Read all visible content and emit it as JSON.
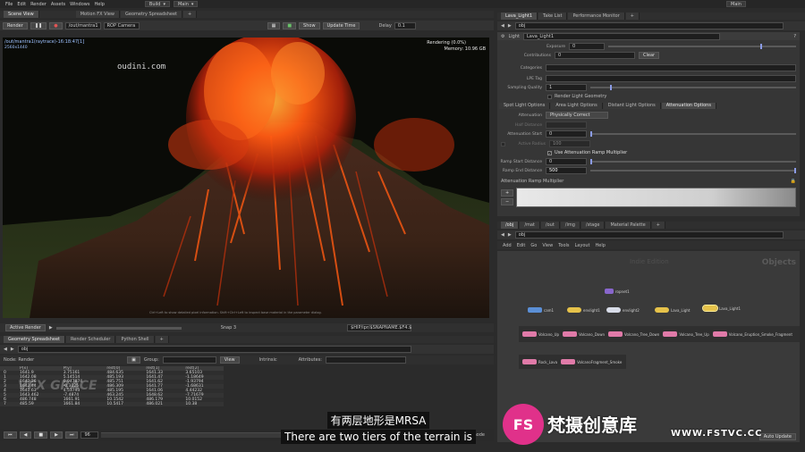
{
  "menu": [
    "File",
    "Edit",
    "Render",
    "Assets",
    "Windows",
    "Help"
  ],
  "desktop": {
    "build": "Build",
    "main": "Main",
    "right_main": "Main"
  },
  "left_tabs": [
    "Scene View",
    "Motion FX View",
    "Geometry Spreadsheet"
  ],
  "right_tabs": [
    "Lava_Light1",
    "Take List",
    "Performance Monitor"
  ],
  "viewport": {
    "render_btn": "Render",
    "node_path": "/out/mantra1",
    "camera": "ROP Camera",
    "show_label": "Show",
    "update_btn": "Update Time",
    "delay_label": "Delay",
    "delay_value": "0.1",
    "info_line1": "/out/mantra1(raytrace)-16:18:47[1]",
    "info_line2": "2560x1440",
    "render_status": "Rendering (0.0%)",
    "memory": "Memory:    10.96 GB",
    "watermark": "oudini.com",
    "hint": "Ctrl+Left to show detailed pixel information. Shift+Ctrl+Left to inspect base material in the parameter dialog.",
    "active_render": "Active Render",
    "snap": "Snap 3",
    "output_path": "$HIP/ipr/$SNAPNAME.$F4.$"
  },
  "spreadsheet": {
    "tabs": [
      "Geometry Spreadsheet",
      "Render Scheduler",
      "Python Shell"
    ],
    "path": "obj",
    "node_label": "Node: Render",
    "group_label": "Group:",
    "view_label": "View",
    "intrinsic_label": "Intrinsic",
    "attributes_label": "Attributes:",
    "columns": [
      "",
      "P[x]",
      "P[y]",
      "rest[0]",
      "rest[1]",
      "rest[2]"
    ],
    "rows": [
      [
        "0",
        "1641.9",
        "3.75161",
        "484.635",
        "1641.33",
        "3.65103"
      ],
      [
        "1",
        "1642.08",
        "5.14514",
        "485.193",
        "1641.47",
        "-1.18649"
      ],
      [
        "2",
        "1642.26",
        "0.947874",
        "485.751",
        "1641.62",
        "-1.93794"
      ],
      [
        "3",
        "1642.44",
        "-0.3125",
        "486.309",
        "1641.77",
        "-1.68631"
      ],
      [
        "4",
        "1641.63",
        "4.53793",
        "485.195",
        "1641.06",
        "4.44232"
      ],
      [
        "5",
        "1643.462",
        "-7.4874",
        "463.245",
        "1648.62",
        "-7.71679"
      ],
      [
        "6",
        "486.748",
        "1661.91",
        "10.1542",
        "486.179",
        "10.0152"
      ],
      [
        "7",
        "485.59",
        "1661.84",
        "10.5417",
        "486.021",
        "10.38"
      ]
    ]
  },
  "timeline": {
    "frame": "96",
    "mode": "mode"
  },
  "params": {
    "node_type": "Light",
    "node_name": "Lava_Light1",
    "path": "obj",
    "exposure_label": "Exposure",
    "exposure_value": "0",
    "contributions_label": "Contributions",
    "contributions_value": "0",
    "clear_label": "Clear",
    "categories_label": "Categories",
    "lpe_label": "LPE Tag",
    "sampling_label": "Sampling Quality",
    "sampling_value": "1",
    "render_light_geo": "Render Light Geometry",
    "sub_tabs": [
      "Spot Light Options",
      "Area Light Options",
      "Distant Light Options",
      "Attenuation Options"
    ],
    "attenuation_label": "Attenuation",
    "attenuation_value": "Physically Correct",
    "half_distance_label": "Half Distance",
    "atten_start_label": "Attenuation Start",
    "atten_start_value": "0",
    "active_radius_label": "Active Radius",
    "active_radius_value": "100",
    "use_ramp_label": "Use Attenuation Ramp Multiplier",
    "ramp_start_label": "Ramp Start Distance",
    "ramp_start_value": "0",
    "ramp_end_label": "Ramp End Distance",
    "ramp_end_value": "500",
    "ramp_multiplier_label": "Attenuation Ramp Multiplier"
  },
  "network": {
    "tabs": [
      "/obj",
      "/mat",
      "/out",
      "/img",
      "/stage",
      "Material Palette"
    ],
    "path": "obj",
    "menu": [
      "Add",
      "Edit",
      "Go",
      "View",
      "Tools",
      "Layout",
      "Help"
    ],
    "context_label": "Objects",
    "mode_label": "Indie Edition",
    "auto_update": "Auto Update",
    "nodes": [
      {
        "label": "cam1",
        "color": "#5b8fd6"
      },
      {
        "label": "envlight1",
        "color": "#e6c24a"
      },
      {
        "label": "envlight2",
        "color": "#d8dce8"
      },
      {
        "label": "Lava_Light",
        "color": "#e6c24a"
      },
      {
        "label": "Lava_Light1",
        "color": "#e6c24a"
      },
      {
        "label": "ropnet1",
        "color": "#8866cc"
      }
    ],
    "row_nodes": [
      "Volcano_Up",
      "Volcano_Down",
      "Volcano_Tree_Down",
      "Volcano_Tree_Up",
      "Volcano_Eruption_Smoke_Fragment"
    ],
    "bottom_nodes": [
      "Rock_Lava",
      "VolcanoFragment_Smoke"
    ]
  },
  "subtitle": {
    "cn": "有两层地形是MRSA",
    "en": "There are two tiers of the terrain is"
  },
  "brand": {
    "name": "梵摄创意库",
    "url": "WWW.FSTVC.CC",
    "logo_text": "FS",
    "watermark_left": "VFX GRACE"
  },
  "colors": {
    "accent": "#8b9be6",
    "subtitle_bg": "#111111",
    "brand_pink": "#e0318a"
  }
}
